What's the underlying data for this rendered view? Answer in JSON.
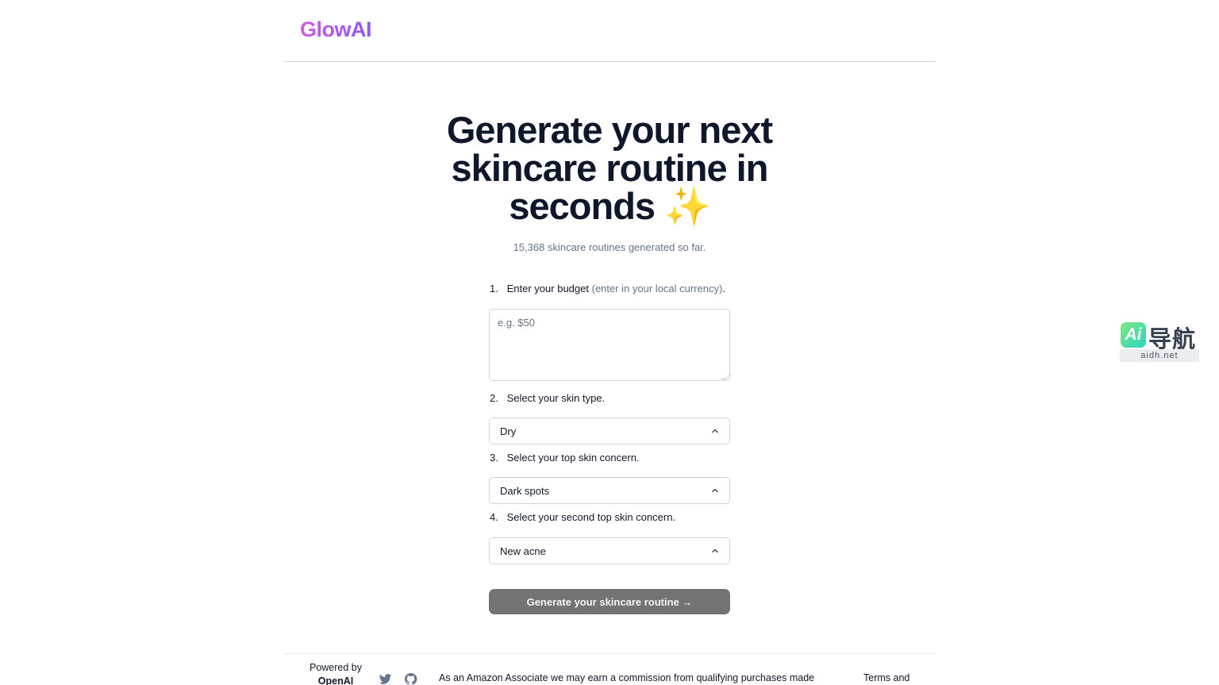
{
  "header": {
    "logo": "GlowAI"
  },
  "hero": {
    "title": "Generate your next skincare routine in seconds",
    "sparkle": "✨",
    "counter": "15,368 skincare routines generated so far."
  },
  "form": {
    "step1": {
      "num": "1.",
      "text": "Enter your budget",
      "hint": "(enter in your local currency)",
      "end": ".",
      "placeholder": "e.g. $50"
    },
    "step2": {
      "num": "2.",
      "text": "Select your skin type.",
      "value": "Dry"
    },
    "step3": {
      "num": "3.",
      "text": "Select your top skin concern.",
      "value": "Dark spots"
    },
    "step4": {
      "num": "4.",
      "text": "Select your second top skin concern.",
      "value": "New acne"
    },
    "submit_label": "Generate your skincare routine →"
  },
  "footer": {
    "powered_by": "Powered by",
    "provider": "OpenAI",
    "disclaimer": "As an Amazon Associate we may earn a commission from qualifying purchases made",
    "terms": "Terms and"
  },
  "watermark": {
    "badge": "Ai",
    "cn": "导航",
    "url": "aidh.net"
  },
  "icons": {
    "social1": "twitter-icon",
    "social2": "github-icon",
    "select": "chevron-up-icon"
  },
  "colors": {
    "logo_gradient": [
      "#d05fd8",
      "#8b5cf6"
    ],
    "button_bg": "#737373",
    "title": "#0f172a",
    "muted": "#64748b"
  }
}
